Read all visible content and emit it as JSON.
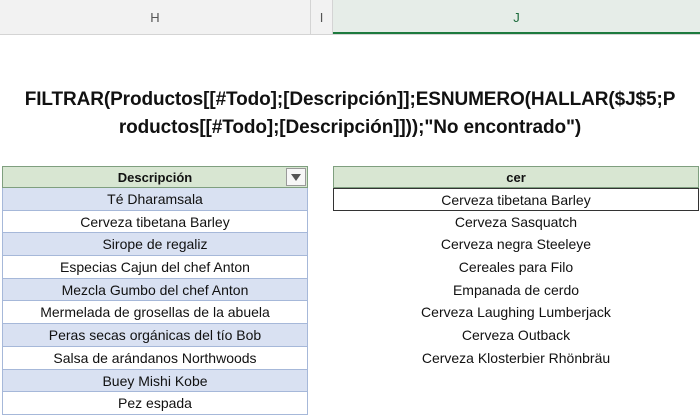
{
  "columns": {
    "h": "H",
    "i": "I",
    "j": "J"
  },
  "formula": {
    "line1": "FILTRAR(Productos[[#Todo];[Descripción]];ESNUMERO(HALLAR($J$5;P",
    "line2": "roductos[[#Todo];[Descripción]]));\"No encontrado\")"
  },
  "table_h": {
    "header": "Descripción",
    "rows": [
      "Té Dharamsala",
      "Cerveza tibetana Barley",
      "Sirope de regaliz",
      "Especias Cajun del chef Anton",
      "Mezcla Gumbo del chef Anton",
      "Mermelada de grosellas de la abuela",
      "Peras secas orgánicas del tío Bob",
      "Salsa de arándanos Northwoods",
      "Buey Mishi Kobe",
      "Pez espada"
    ]
  },
  "table_j": {
    "header": "cer",
    "rows": [
      "Cerveza tibetana Barley",
      "Cerveza Sasquatch",
      "Cerveza negra Steeleye",
      "Cereales para Filo",
      "Empanada de cerdo",
      "Cerveza Laughing Lumberjack",
      "Cerveza Outback",
      "Cerveza Klosterbier Rhönbräu"
    ]
  }
}
